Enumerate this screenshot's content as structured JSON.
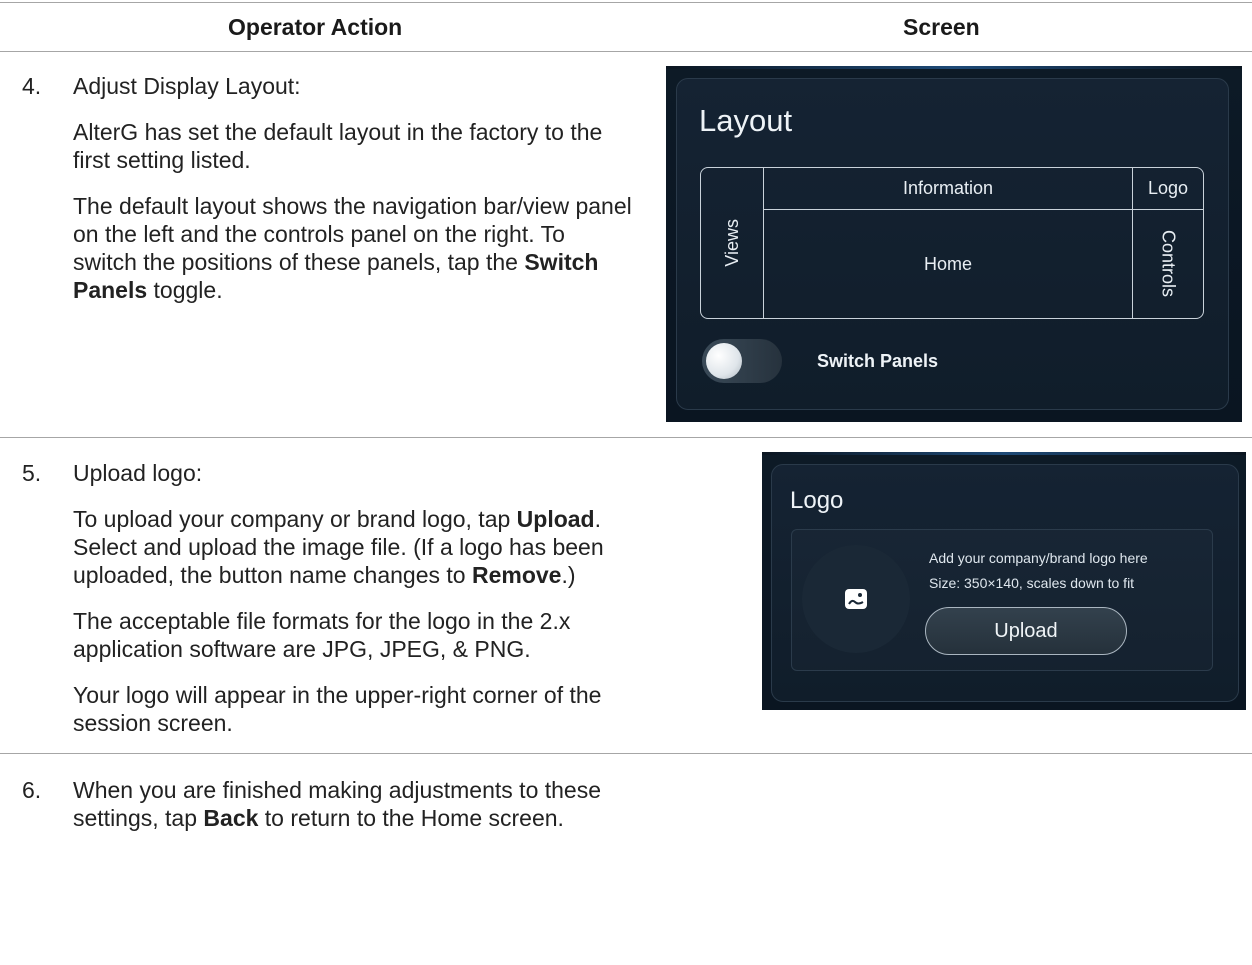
{
  "table": {
    "header_action": "Operator Action",
    "header_screen": "Screen"
  },
  "steps": [
    {
      "number": "4.",
      "title": "Adjust Display Layout:",
      "p1": "AlterG has set the default layout in the factory to the first setting listed.",
      "p2_a": "The default layout shows the navigation bar/view panel on the left and the controls panel on the right. To switch the positions of these panels, tap the ",
      "p2_bold": "Switch Panels",
      "p2_b": " toggle."
    },
    {
      "number": "5.",
      "title": "Upload logo:",
      "p1_a": "To upload your company or brand logo, tap ",
      "p1_bold1": "Upload",
      "p1_b": ". Select and upload the image file. (If a logo has been uploaded, the button name changes to ",
      "p1_bold2": "Remove",
      "p1_c": ".)",
      "p2": "The acceptable file formats for the logo in the 2.x application software are JPG, JPEG, & PNG.",
      "p3": "Your logo will appear in the upper-right corner of the session screen."
    },
    {
      "number": "6.",
      "p1_a": "When you are finished making adjustments to these settings, tap ",
      "p1_bold": "Back",
      "p1_b": " to return to the Home screen."
    }
  ],
  "layout_screen": {
    "title": "Layout",
    "cell_information": "Information",
    "cell_logo": "Logo",
    "cell_views": "Views",
    "cell_home": "Home",
    "cell_controls": "Controls",
    "toggle_label": "Switch Panels",
    "toggle_on": false
  },
  "logo_screen": {
    "title": "Logo",
    "line1": "Add your company/brand logo here",
    "line2": "Size: 350×140, scales down to fit",
    "button": "Upload",
    "icon": "image-icon"
  }
}
